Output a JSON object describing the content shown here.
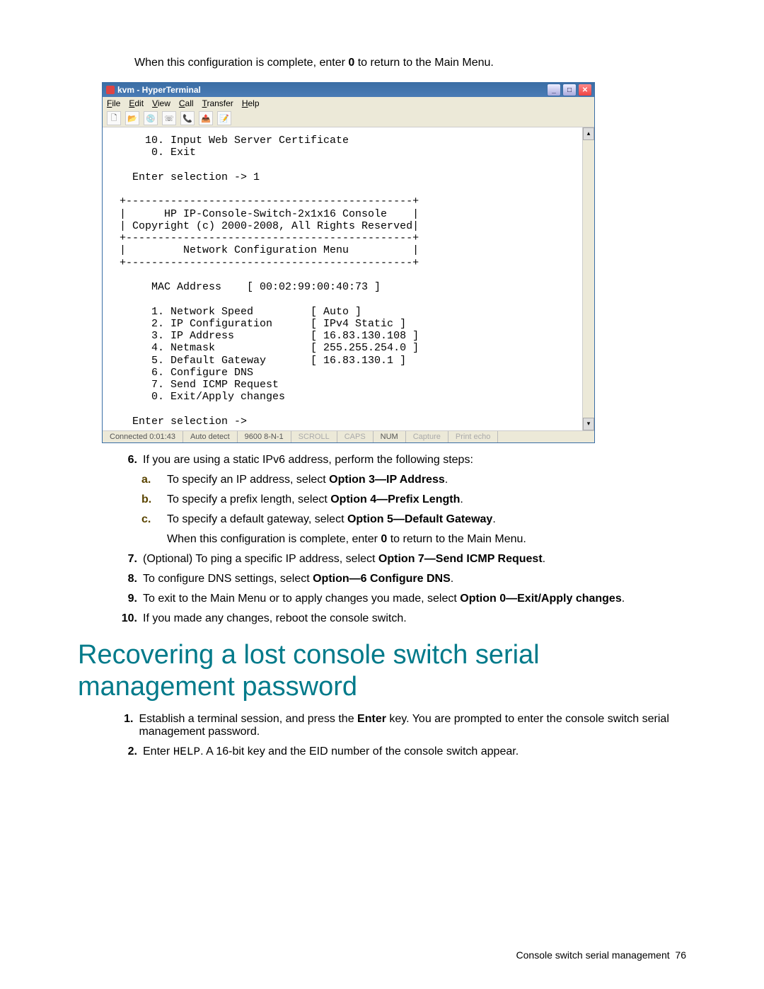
{
  "intro": {
    "prefix": "When this configuration is complete, enter ",
    "key": "0",
    "suffix": " to return to the Main Menu."
  },
  "window": {
    "title": "kvm - HyperTerminal",
    "menu": {
      "file": "File",
      "edit": "Edit",
      "view": "View",
      "call": "Call",
      "transfer": "Transfer",
      "help": "Help"
    },
    "terminal_text": "    10. Input Web Server Certificate\n     0. Exit\n\n  Enter selection -> 1\n\n+---------------------------------------------+\n|      HP IP-Console-Switch-2x1x16 Console    |\n| Copyright (c) 2000-2008, All Rights Reserved|\n+---------------------------------------------+\n|         Network Configuration Menu          |\n+---------------------------------------------+\n\n     MAC Address    [ 00:02:99:00:40:73 ]\n\n     1. Network Speed         [ Auto ]\n     2. IP Configuration      [ IPv4 Static ]\n     3. IP Address            [ 16.83.130.108 ]\n     4. Netmask               [ 255.255.254.0 ]\n     5. Default Gateway       [ 16.83.130.1 ]\n     6. Configure DNS\n     7. Send ICMP Request\n     0. Exit/Apply changes\n\n  Enter selection ->",
    "status": {
      "connected": "Connected 0:01:43",
      "auto": "Auto detect",
      "baud": "9600 8-N-1",
      "scroll": "SCROLL",
      "caps": "CAPS",
      "num": "NUM",
      "capture": "Capture",
      "printecho": "Print echo"
    }
  },
  "list": {
    "s6": {
      "num": "6.",
      "text": "If you are using a static IPv6 address, perform the following steps:",
      "a": {
        "l": "a.",
        "pre": "To specify an IP address, select ",
        "bold": "Option 3—IP Address",
        "post": "."
      },
      "b": {
        "l": "b.",
        "pre": "To specify a prefix length, select ",
        "bold": "Option 4—Prefix Length",
        "post": "."
      },
      "c": {
        "l": "c.",
        "pre": "To specify a default gateway, select ",
        "bold": "Option 5—Default Gateway",
        "post": "."
      },
      "tail": {
        "pre": "When this configuration is complete, enter ",
        "bold": "0",
        "post": " to return to the Main Menu."
      }
    },
    "s7": {
      "num": "7.",
      "pre": "(Optional) To ping a specific IP address, select ",
      "bold": "Option 7—Send ICMP Request",
      "post": "."
    },
    "s8": {
      "num": "8.",
      "pre": "To configure DNS settings, select ",
      "bold": "Option—6 Configure DNS",
      "post": "."
    },
    "s9": {
      "num": "9.",
      "pre": "To exit to the Main Menu or to apply changes you made, select ",
      "bold": "Option 0—Exit/Apply changes",
      "post": "."
    },
    "s10": {
      "num": "10.",
      "text": "If you made any changes, reboot the console switch."
    }
  },
  "heading": "Recovering a lost console switch serial management password",
  "recover": {
    "s1": {
      "num": "1.",
      "pre": "Establish a terminal session, and press the ",
      "bold": "Enter",
      "post": " key. You are prompted to enter the console switch serial management password."
    },
    "s2": {
      "num": "2.",
      "pre": "Enter ",
      "code": "HELP",
      "post": ". A 16-bit key and the EID number of the console switch appear."
    }
  },
  "footer": {
    "text": "Console switch serial management",
    "page": "76"
  }
}
